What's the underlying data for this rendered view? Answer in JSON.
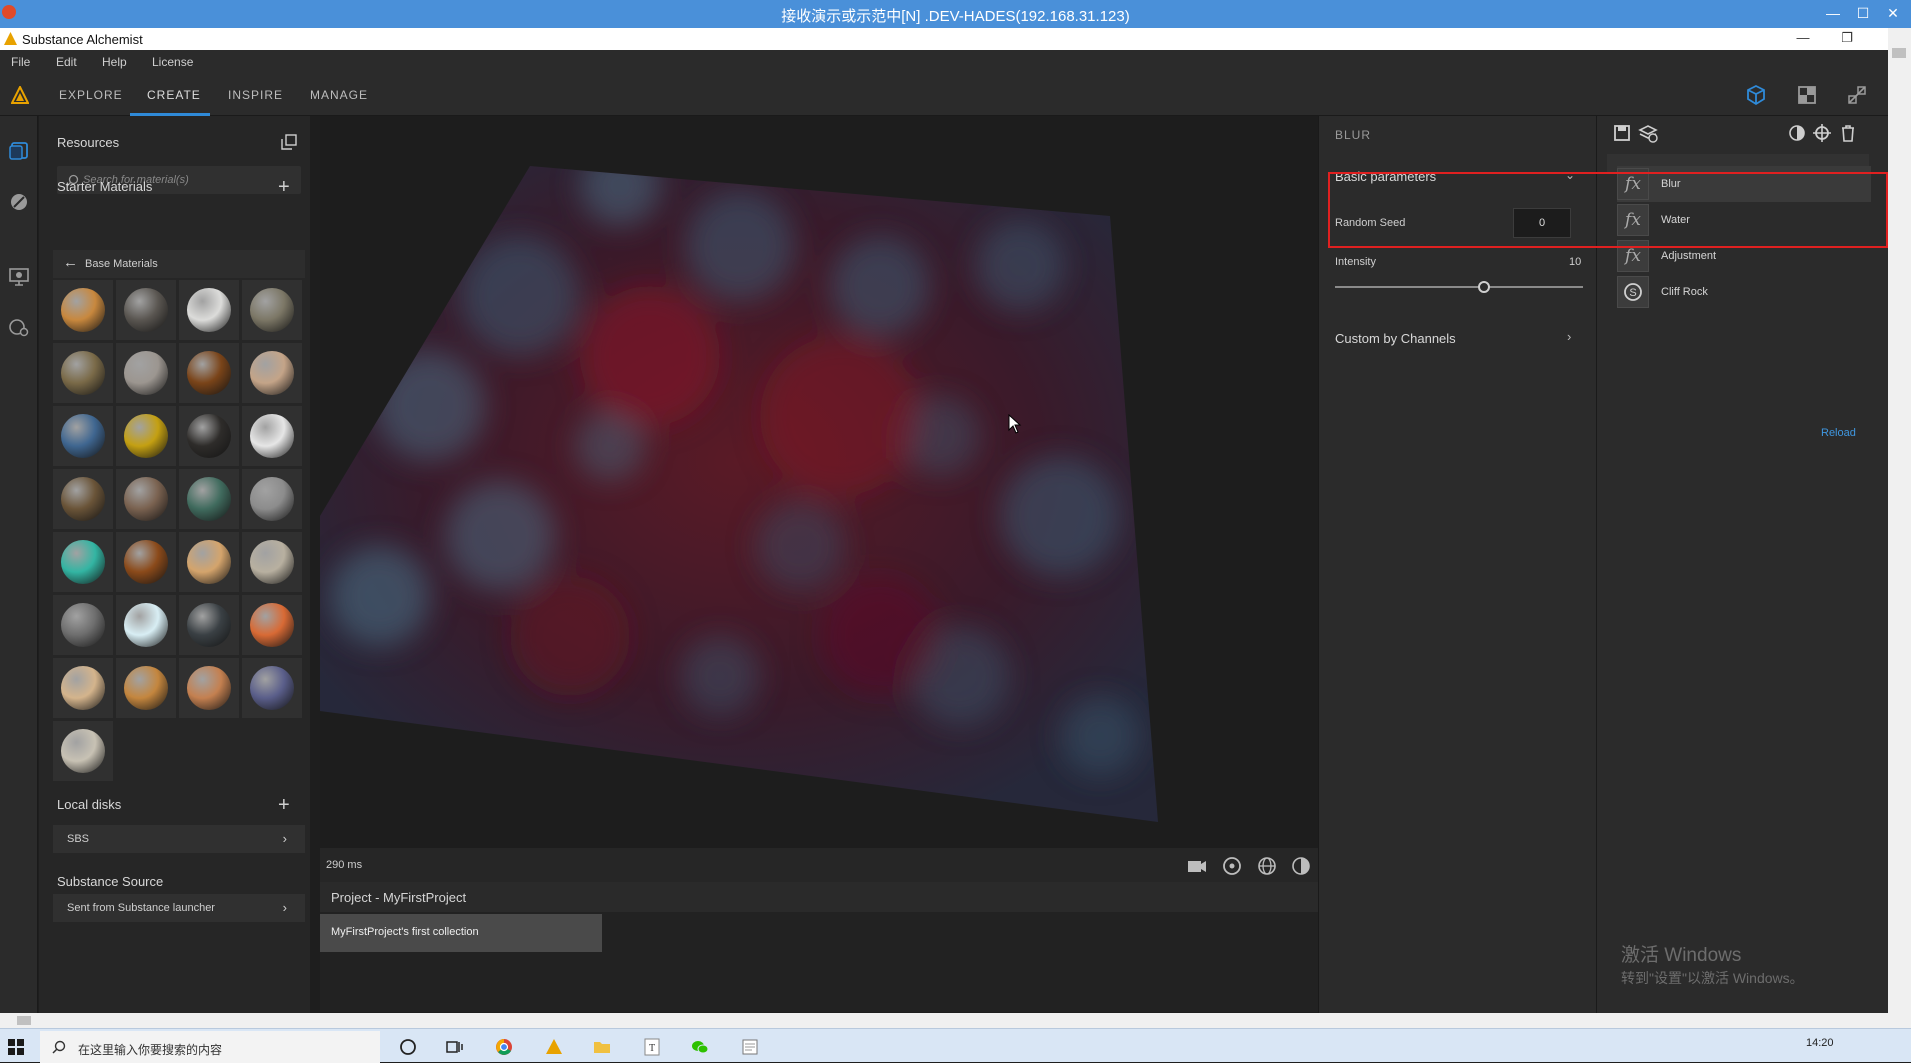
{
  "remote_window": {
    "title": "接收演示或示范中[N] .DEV-HADES(192.168.31.123)",
    "controls": [
      "—",
      "☐",
      "✕"
    ]
  },
  "app": {
    "title": "Substance Alchemist",
    "window_controls": [
      "—",
      "❐",
      "✕"
    ]
  },
  "menu": [
    "File",
    "Edit",
    "Help",
    "License"
  ],
  "nav_tabs": [
    {
      "label": "EXPLORE",
      "active": false
    },
    {
      "label": "CREATE",
      "active": true
    },
    {
      "label": "INSPIRE",
      "active": false
    },
    {
      "label": "MANAGE",
      "active": false
    }
  ],
  "nav_right_icons": [
    "3d-view-icon",
    "2d-view-icon",
    "split-view-icon"
  ],
  "left_rail_icons": [
    "resources-icon",
    "material-icon",
    "render-icon",
    "settings-icon"
  ],
  "resources": {
    "title": "Resources",
    "search_placeholder": "Search for material(s)",
    "starter_title": "Starter Materials",
    "base_materials_label": "Base Materials",
    "materials": [
      "#c8883e",
      "#5a5651",
      "#dcdcda",
      "#7c7766",
      "#7a6a48",
      "#9c9690",
      "#7a4419",
      "#c4a488",
      "#3f6690",
      "#c4a012",
      "#2e2c2a",
      "#e6e6e6",
      "#6a5438",
      "#7a6250",
      "#406b5e",
      "#8c8c8c",
      "#33b5a3",
      "#8b4a1a",
      "#d4a46c",
      "#b8b0a0",
      "#6e6e6e",
      "#d8eef4",
      "#3a4044",
      "#d86a35",
      "#d4b48c",
      "#c4863e",
      "#c48050",
      "#5a5e8a",
      "#c8c2b4"
    ],
    "local_disks_title": "Local disks",
    "local_disks": [
      "SBS"
    ],
    "source_title": "Substance Source",
    "source_items": [
      "Sent from Substance launcher"
    ]
  },
  "viewport": {
    "render_time": "290 ms",
    "toolbar_icons": [
      "camera-icon",
      "rotate-view-icon",
      "environment-icon",
      "display-mode-icon"
    ]
  },
  "project": {
    "title": "Project - MyFirstProject",
    "collection": "MyFirstProject's first collection"
  },
  "parameters": {
    "title": "BLUR",
    "basic_section": "Basic parameters",
    "random_seed_label": "Random Seed",
    "random_seed_value": "0",
    "intensity_label": "Intensity",
    "intensity_value": "10",
    "intensity_fraction": 0.6,
    "custom_section": "Custom by Channels"
  },
  "layers": {
    "toolbar_left": [
      "save-icon",
      "layers-icon"
    ],
    "toolbar_right": [
      "mask-icon",
      "add-filter-icon",
      "trash-icon"
    ],
    "items": [
      {
        "label": "Blur",
        "icon": "fx",
        "selected": true
      },
      {
        "label": "Water",
        "icon": "fx",
        "selected": false
      },
      {
        "label": "Adjustment",
        "icon": "fx",
        "selected": false
      },
      {
        "label": "Cliff Rock",
        "icon": "S",
        "selected": false
      }
    ],
    "reload_label": "Reload"
  },
  "watermark": {
    "line1": "激活 Windows",
    "line2": "转到\"设置\"以激活 Windows。"
  },
  "taskbar": {
    "search_text": "在这里输入你要搜索的内容",
    "clock": "14:20",
    "icons": [
      "cortana-icon",
      "task-view-icon",
      "chrome-icon",
      "substance-icon",
      "folder-icon",
      "typora-icon",
      "wechat-icon",
      "notepad-icon"
    ]
  },
  "colors": {
    "accent": "#2f8ad8",
    "highlight_box": "#e02020",
    "link": "#3f97e0"
  }
}
